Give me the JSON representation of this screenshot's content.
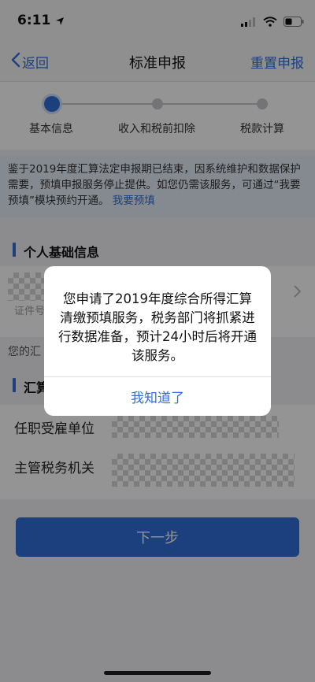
{
  "status": {
    "time": "6:11"
  },
  "nav": {
    "back_label": "返回",
    "title": "标准申报",
    "reset_label": "重置申报"
  },
  "steps": [
    {
      "label": "基本信息",
      "active": true
    },
    {
      "label": "收入和税前扣除",
      "active": false
    },
    {
      "label": "税款计算",
      "active": false
    }
  ],
  "notice": {
    "text": "鉴于2019年度汇算法定申报期已结束，因系统维护和数据保护需要，预填申报服务停止提供。如您仍需该服务，可通过“我要预填”模块预约开通。",
    "link": "我要预填"
  },
  "sections": {
    "personal_title": "个人基础信息",
    "summary_title": "汇算"
  },
  "identity": {
    "id_sub_label": "证件号"
  },
  "gray_note": "您的汇",
  "fields": {
    "employer_label": "任职受雇单位",
    "tax_office_label": "主管税务机关"
  },
  "next_button_label": "下一步",
  "dialog": {
    "message": "您申请了2019年度综合所得汇算清缴预填服务，税务部门将抓紧进行数据准备，预计24小时后将开通该服务。",
    "button_label": "我知道了"
  },
  "colors": {
    "accent": "#2f6fd8"
  }
}
